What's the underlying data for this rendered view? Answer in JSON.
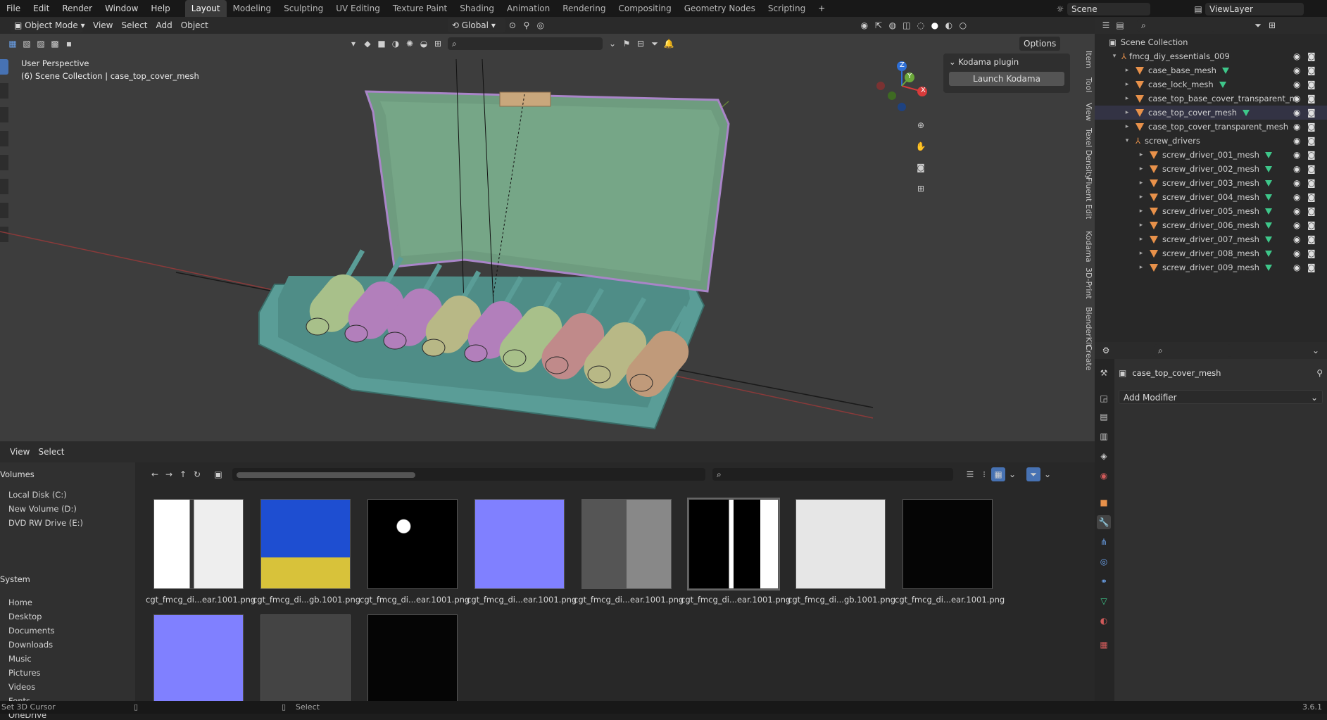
{
  "menu": [
    "File",
    "Edit",
    "Render",
    "Window",
    "Help"
  ],
  "workspaces": [
    "Layout",
    "Modeling",
    "Sculpting",
    "UV Editing",
    "Texture Paint",
    "Shading",
    "Animation",
    "Rendering",
    "Compositing",
    "Geometry Nodes",
    "Scripting"
  ],
  "active_workspace": "Layout",
  "add_workspace": "+",
  "scene_field": "Scene",
  "viewlayer_field": "ViewLayer",
  "viewport": {
    "mode": "Object Mode",
    "menus": [
      "View",
      "Select",
      "Add",
      "Object"
    ],
    "transform_orientation": "Global",
    "perspective_label": "User Perspective",
    "collection_label": "(6) Scene Collection | case_top_cover_mesh",
    "options_label": "Options",
    "axis_labels": [
      "X",
      "Y",
      "Z"
    ],
    "side_tabs": [
      "Item",
      "Tool",
      "View",
      "Texel Density",
      "Fluent",
      "Edit",
      "Kodama",
      "3D-Print",
      "BlenderKit",
      "Create"
    ],
    "plugin_panel": {
      "title": "Kodama plugin",
      "button": "Launch Kodama"
    }
  },
  "outliner": {
    "root": "Scene Collection",
    "collection": "fmcg_diy_essentials_009",
    "items": [
      {
        "name": "case_base_mesh",
        "depth": 2,
        "modifier": true
      },
      {
        "name": "case_lock_mesh",
        "depth": 2,
        "modifier": true
      },
      {
        "name": "case_top_base_cover_transparent_m",
        "depth": 2,
        "modifier": false
      },
      {
        "name": "case_top_cover_mesh",
        "depth": 2,
        "modifier": true
      },
      {
        "name": "case_top_cover_transparent_mesh",
        "depth": 2,
        "modifier": false
      },
      {
        "name": "screw_drivers",
        "depth": 2,
        "modifier": false,
        "collection": true
      },
      {
        "name": "screw_driver_001_mesh",
        "depth": 3,
        "modifier": true
      },
      {
        "name": "screw_driver_002_mesh",
        "depth": 3,
        "modifier": true
      },
      {
        "name": "screw_driver_003_mesh",
        "depth": 3,
        "modifier": true
      },
      {
        "name": "screw_driver_004_mesh",
        "depth": 3,
        "modifier": true
      },
      {
        "name": "screw_driver_005_mesh",
        "depth": 3,
        "modifier": true
      },
      {
        "name": "screw_driver_006_mesh",
        "depth": 3,
        "modifier": true
      },
      {
        "name": "screw_driver_007_mesh",
        "depth": 3,
        "modifier": true
      },
      {
        "name": "screw_driver_008_mesh",
        "depth": 3,
        "modifier": true
      },
      {
        "name": "screw_driver_009_mesh",
        "depth": 3,
        "modifier": true
      }
    ]
  },
  "properties": {
    "object_name": "case_top_cover_mesh",
    "add_modifier": "Add Modifier"
  },
  "filebrowser": {
    "menus": [
      "View",
      "Select"
    ],
    "volumes_title": "Volumes",
    "volumes": [
      "Local Disk (C:)",
      "New Volume (D:)",
      "DVD RW Drive (E:)"
    ],
    "system_title": "System",
    "system": [
      "Home",
      "Desktop",
      "Documents",
      "Downloads",
      "Music",
      "Pictures",
      "Videos",
      "Fonts",
      "OneDrive"
    ],
    "thumbnails": [
      {
        "label": "cgt_fmcg_di...ear.1001.png",
        "style": "bw-mixed"
      },
      {
        "label": "cgt_fmcg_di...gb.1001.png",
        "style": "blue-label"
      },
      {
        "label": "cgt_fmcg_di...ear.1001.png",
        "style": "black-white"
      },
      {
        "label": "cgt_fmcg_di...ear.1001.png",
        "style": "normal"
      },
      {
        "label": "cgt_fmcg_di...ear.1001.png",
        "style": "grey-mixed"
      },
      {
        "label": "cgt_fmcg_di...ear.1001.png",
        "style": "black-panels"
      },
      {
        "label": "cgt_fmcg_di...gb.1001.png",
        "style": "white"
      },
      {
        "label": "cgt_fmcg_di...ear.1001.png",
        "style": "black"
      },
      {
        "label": "",
        "style": "normal"
      },
      {
        "label": "",
        "style": "grey"
      },
      {
        "label": "",
        "style": "black"
      }
    ]
  },
  "status": {
    "left": "Set 3D Cursor",
    "mid": "Select",
    "version": "3.6.1"
  },
  "colors": {
    "viewport_bg": "#3d3d3d",
    "case": "#5b9e98",
    "cover": "#6f9b7e",
    "handles": [
      "#a8c08a",
      "#b27fbb",
      "#b27fbb",
      "#b8b886",
      "#b27fbb",
      "#a8c08a",
      "#c08a8a",
      "#b8b886",
      "#c09a7a"
    ],
    "normal_map": "#8080ff",
    "mesh_icon": "#e8914a",
    "modifier_icon": "#3ec78a"
  }
}
